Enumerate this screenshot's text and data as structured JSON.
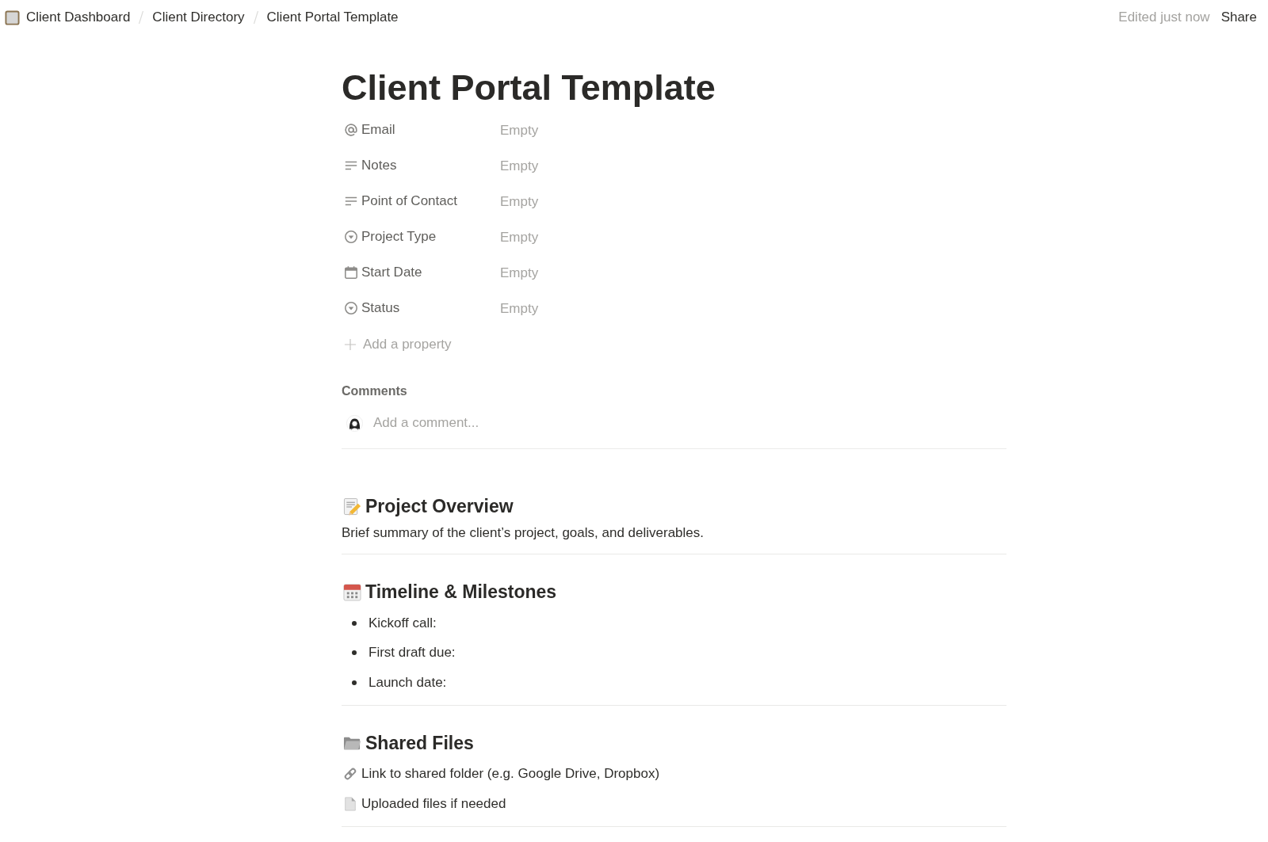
{
  "breadcrumbs": [
    "Client Dashboard",
    "Client Directory",
    "Client Portal Template"
  ],
  "header_actions": {
    "edited_status": "Edited just now",
    "share": "Share"
  },
  "title": "Client Portal Template",
  "properties": [
    {
      "kind": "email",
      "label": "Email",
      "placeholder": "Empty"
    },
    {
      "kind": "text",
      "label": "Notes",
      "placeholder": "Empty"
    },
    {
      "kind": "text",
      "label": "Point of Contact",
      "placeholder": "Empty"
    },
    {
      "kind": "select",
      "label": "Project Type",
      "placeholder": "Empty"
    },
    {
      "kind": "date",
      "label": "Start Date",
      "placeholder": "Empty"
    },
    {
      "kind": "select",
      "label": "Status",
      "placeholder": "Empty"
    }
  ],
  "add_property": "Add a property",
  "comments": {
    "heading": "Comments",
    "placeholder": "Add a comment..."
  },
  "sections": [
    {
      "heading": "Project Overview",
      "blocks": [
        {
          "kind": "paragraph",
          "text": "Brief summary of the client’s project, goals, and deliverables."
        }
      ]
    },
    {
      "heading": "Timeline & Milestones",
      "blocks": [
        {
          "kind": "bullet",
          "text": "Kickoff call:"
        },
        {
          "kind": "bullet",
          "text": "First draft due:"
        },
        {
          "kind": "bullet",
          "text": "Launch date:"
        }
      ]
    },
    {
      "heading": "Shared Files",
      "blocks": [
        {
          "kind": "link_note",
          "text": "Link to shared folder (e.g. Google Drive, Dropbox)"
        },
        {
          "kind": "file_note",
          "text": "Uploaded files if needed"
        }
      ]
    }
  ]
}
